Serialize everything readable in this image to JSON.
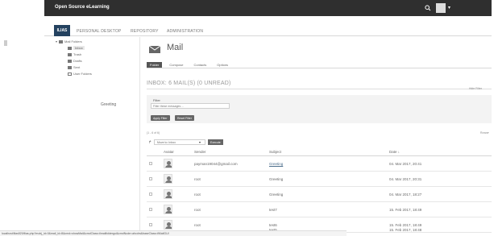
{
  "app": {
    "title": "Open Source eLearning",
    "logo": "ILIAS"
  },
  "nav": [
    {
      "label": "PERSONAL DESKTOP"
    },
    {
      "label": "REPOSITORY"
    },
    {
      "label": "ADMINISTRATION"
    }
  ],
  "sidebar": {
    "folder_root": "Mail Folders",
    "items": [
      {
        "label": "Inbox"
      },
      {
        "label": "Trash"
      },
      {
        "label": "Drafts"
      },
      {
        "label": "Sent"
      },
      {
        "label": "User Folders"
      }
    ],
    "preview": "Greeting"
  },
  "main": {
    "title": "Mail",
    "tabs": [
      {
        "label": "Folder"
      },
      {
        "label": "Compose"
      },
      {
        "label": "Contacts"
      },
      {
        "label": "Options"
      }
    ],
    "folder_heading": "INBOX: 6 MAIL(S) (0 UNREAD)",
    "hide_filter": "Hide Filter",
    "filter": {
      "label": "Filter",
      "placeholder": "Filter these messages ...",
      "apply": "Apply Filter",
      "reset": "Reset Filter"
    },
    "rowcount": "(1 - 6 of 6)",
    "rows_label": "Rows",
    "bulk": {
      "selected": "Move to: Inbox",
      "execute": "Execute"
    },
    "table": {
      "headers": [
        "Avatar",
        "Sender",
        "Subject",
        "Date"
      ],
      "rows": [
        {
          "sender": "payman19044@gmail.com",
          "subject": "Greeting",
          "date": "04. Mar 2017, 20:41"
        },
        {
          "sender": "root",
          "subject": "Greeting",
          "date": "04. Mar 2017, 20:31"
        },
        {
          "sender": "root",
          "subject": "Greeting",
          "date": "04. Mar 2017, 18:27"
        },
        {
          "sender": "root",
          "subject": "test7",
          "date": "15. Feb 2017, 18:49"
        },
        {
          "sender": "root",
          "subject": "test6",
          "date": "15. Feb 2017, 18:49"
        },
        {
          "sender": "",
          "subject": "test5",
          "date": "15. Feb 2017, 18:48"
        }
      ]
    }
  },
  "statusbar": {
    "url": "localhost/ilias520/ilias.php?mobj_id=0&mail_id=8&cmd=showMail&cmdClass=ilmailfoldergui&cmdNode=ahcdm&baseClass=ilMailGUI"
  }
}
